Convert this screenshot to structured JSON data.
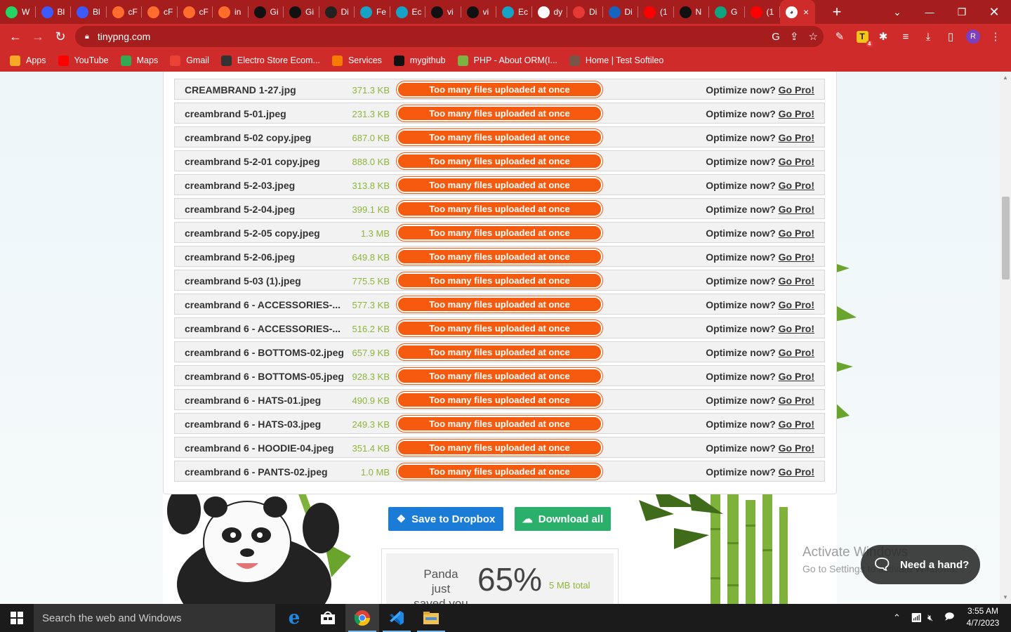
{
  "browser": {
    "tabs": [
      {
        "label": "W",
        "icon": "whatsapp-icon",
        "color": "#25d366"
      },
      {
        "label": "Bl",
        "icon": "grid-icon",
        "color": "#3d5afe"
      },
      {
        "label": "Bl",
        "icon": "grid-icon",
        "color": "#3d5afe"
      },
      {
        "label": "cF",
        "icon": "cpanel-icon",
        "color": "#ff6c2c"
      },
      {
        "label": "cF",
        "icon": "cpanel-icon",
        "color": "#ff6c2c"
      },
      {
        "label": "cF",
        "icon": "cpanel-icon",
        "color": "#ff6c2c"
      },
      {
        "label": "in",
        "icon": "cpanel-icon",
        "color": "#ff6c2c"
      },
      {
        "label": "Gi",
        "icon": "github-icon",
        "color": "#111111"
      },
      {
        "label": "Gi",
        "icon": "github-icon",
        "color": "#111111"
      },
      {
        "label": "Di",
        "icon": "dark-icon",
        "color": "#222222"
      },
      {
        "label": "Fe",
        "icon": "tool-icon",
        "color": "#16a3c5"
      },
      {
        "label": "Ec",
        "icon": "tool-icon",
        "color": "#16a3c5"
      },
      {
        "label": "vi",
        "icon": "github-icon",
        "color": "#111111"
      },
      {
        "label": "vi",
        "icon": "github-icon",
        "color": "#111111"
      },
      {
        "label": "Ec",
        "icon": "tool-icon",
        "color": "#16a3c5"
      },
      {
        "label": "dy",
        "icon": "google-icon",
        "color": "#ffffff"
      },
      {
        "label": "Di",
        "icon": "hc-icon",
        "color": "#e53935"
      },
      {
        "label": "Di",
        "icon": "word-icon",
        "color": "#1565c0"
      },
      {
        "label": "(1",
        "icon": "youtube-icon",
        "color": "#ff0000"
      },
      {
        "label": "N",
        "icon": "github-icon",
        "color": "#111111"
      },
      {
        "label": "G",
        "icon": "chatgpt-icon",
        "color": "#10a37f"
      },
      {
        "label": "(1",
        "icon": "youtube-icon",
        "color": "#ff0000"
      }
    ],
    "active_tab": {
      "icon": "panda-icon",
      "close": "×"
    },
    "new_tab": "+",
    "url": "tinypng.com",
    "bookmarks": [
      {
        "label": "Apps",
        "icon": "apps-grid-icon",
        "color": "#f9a825"
      },
      {
        "label": "YouTube",
        "icon": "youtube-icon",
        "color": "#ff0000"
      },
      {
        "label": "Maps",
        "icon": "maps-icon",
        "color": "#34a853"
      },
      {
        "label": "Gmail",
        "icon": "gmail-icon",
        "color": "#ea4335"
      },
      {
        "label": "Electro Store Ecom...",
        "icon": "w3-icon",
        "color": "#333333"
      },
      {
        "label": "Services",
        "icon": "services-icon",
        "color": "#f57c00"
      },
      {
        "label": "mygithub",
        "icon": "github-icon",
        "color": "#111111"
      },
      {
        "label": "PHP - About ORM(I...",
        "icon": "php-icon",
        "color": "#7cb342"
      },
      {
        "label": "Home | Test Softileo",
        "icon": "home-icon",
        "color": "#795548"
      }
    ],
    "profile_initial": "R",
    "ext_badge": "4"
  },
  "files": {
    "rows": [
      {
        "name": "CREAMBRAND 1-27.jpg",
        "size": "371.3 KB"
      },
      {
        "name": "creambrand 5-01.jpeg",
        "size": "231.3 KB"
      },
      {
        "name": "creambrand 5-02 copy.jpeg",
        "size": "687.0 KB"
      },
      {
        "name": "creambrand 5-2-01 copy.jpeg",
        "size": "888.0 KB"
      },
      {
        "name": "creambrand 5-2-03.jpeg",
        "size": "313.8 KB"
      },
      {
        "name": "creambrand 5-2-04.jpeg",
        "size": "399.1 KB"
      },
      {
        "name": "creambrand 5-2-05 copy.jpeg",
        "size": "1.3 MB"
      },
      {
        "name": "creambrand 5-2-06.jpeg",
        "size": "649.8 KB"
      },
      {
        "name": "creambrand 5-03 (1).jpeg",
        "size": "775.5 KB"
      },
      {
        "name": "creambrand 6 - ACCESSORIES-...",
        "size": "577.3 KB"
      },
      {
        "name": "creambrand 6 - ACCESSORIES-...",
        "size": "516.2 KB"
      },
      {
        "name": "creambrand 6 - BOTTOMS-02.jpeg",
        "size": "657.9 KB"
      },
      {
        "name": "creambrand 6 - BOTTOMS-05.jpeg",
        "size": "928.3 KB"
      },
      {
        "name": "creambrand 6 - HATS-01.jpeg",
        "size": "490.9 KB"
      },
      {
        "name": "creambrand 6 - HATS-03.jpeg",
        "size": "249.3 KB"
      },
      {
        "name": "creambrand 6 - HOODIE-04.jpeg",
        "size": "351.4 KB"
      },
      {
        "name": "creambrand 6 - PANTS-02.jpeg",
        "size": "1.0 MB"
      }
    ],
    "status_text": "Too many files uploaded at once",
    "optimize_text": "Optimize now?",
    "go_pro_text": "Go Pro!"
  },
  "actions": {
    "dropbox_label": "Save to Dropbox",
    "download_label": "Download all"
  },
  "savings": {
    "line1": "Panda just",
    "line2": "saved you",
    "percent": "65%",
    "total": "5 MB total"
  },
  "overlay": {
    "watermark_title": "Activate Windows",
    "watermark_sub": "Go to Settings to activate Windows.",
    "help_label": "Need a hand?"
  },
  "taskbar": {
    "search_placeholder": "Search the web and Windows",
    "time": "3:55 AM",
    "date": "4/7/2023"
  },
  "colors": {
    "chrome_frame": "#a51d1d",
    "chrome_toolbar": "#cf2b2b",
    "status_orange": "#f55a0e",
    "size_green": "#8db63a",
    "dropbox_blue": "#1b7cd8",
    "download_green": "#2bb06b"
  }
}
